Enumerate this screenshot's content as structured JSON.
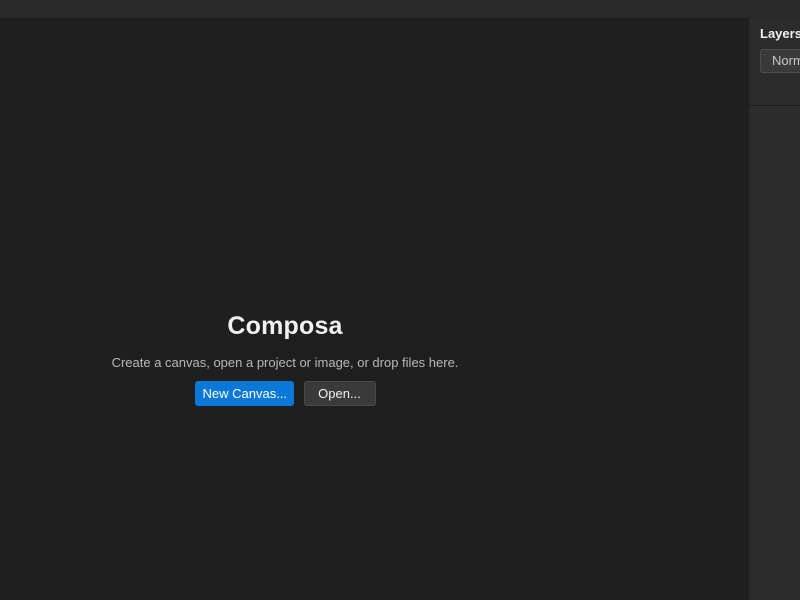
{
  "app": {
    "name": "Composa"
  },
  "welcome": {
    "title": "Composa",
    "description": "Create a canvas, open a project or image, or drop files here.",
    "new_canvas_label": "New Canvas...",
    "open_label": "Open..."
  },
  "layers_panel": {
    "title": "Layers",
    "blend_mode": "Norm"
  },
  "colors": {
    "background": "#1f1f1f",
    "panel": "#2c2c2c",
    "accent": "#0a78d8"
  }
}
